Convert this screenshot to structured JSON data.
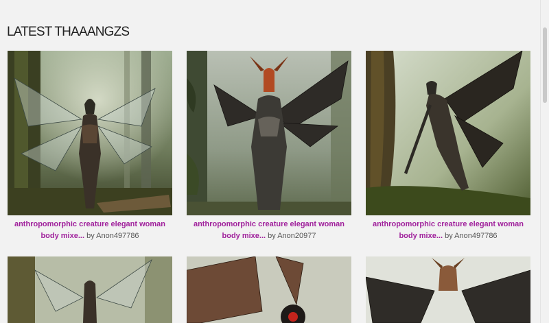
{
  "section": {
    "title": "LATEST THAAANGZS"
  },
  "cards": [
    {
      "title": "anthropomorphic creature elegant woman body mixe...",
      "by": "by",
      "author": "Anon497786",
      "image": "winged-creature-forest-art"
    },
    {
      "title": "anthropomorphic creature elegant woman body mixe...",
      "by": "by",
      "author": "Anon20977",
      "image": "winged-creature-forest-art"
    },
    {
      "title": "anthropomorphic creature elegant woman body mixe...",
      "by": "by",
      "author": "Anon497786",
      "image": "winged-creature-forest-art"
    },
    {
      "image": "winged-creature-forest-art"
    },
    {
      "image": "winged-insect-creature-art"
    },
    {
      "image": "horned-insect-creature-art"
    }
  ],
  "colors": {
    "background": "#f2f2f2",
    "title_link": "#a0219c",
    "heading": "#222222"
  }
}
